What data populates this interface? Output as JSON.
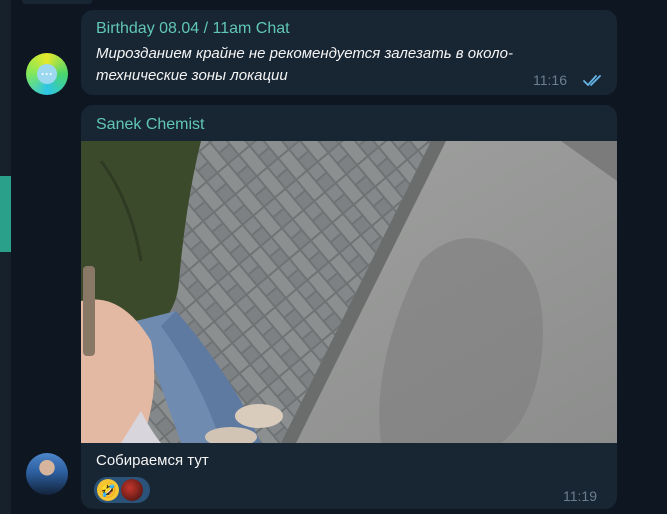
{
  "messages": [
    {
      "sender": "Birthday 08.04 / 11am Chat",
      "text": "Мирозданием крайне не рекомендуется залезать в около-технические зоны локации",
      "time": "11:16",
      "status": "read"
    },
    {
      "sender": "Sanek Chemist",
      "caption": "Собираемся тут",
      "time": "11:19",
      "reactions": [
        "🤣"
      ]
    }
  ],
  "colors": {
    "chat_bg": "#0e1621",
    "bubble_bg": "#182533",
    "sender_color": "#60c7b5",
    "accent": "#2aa08b",
    "time_color": "#6d7f8f",
    "check_color": "#64b4e6"
  }
}
